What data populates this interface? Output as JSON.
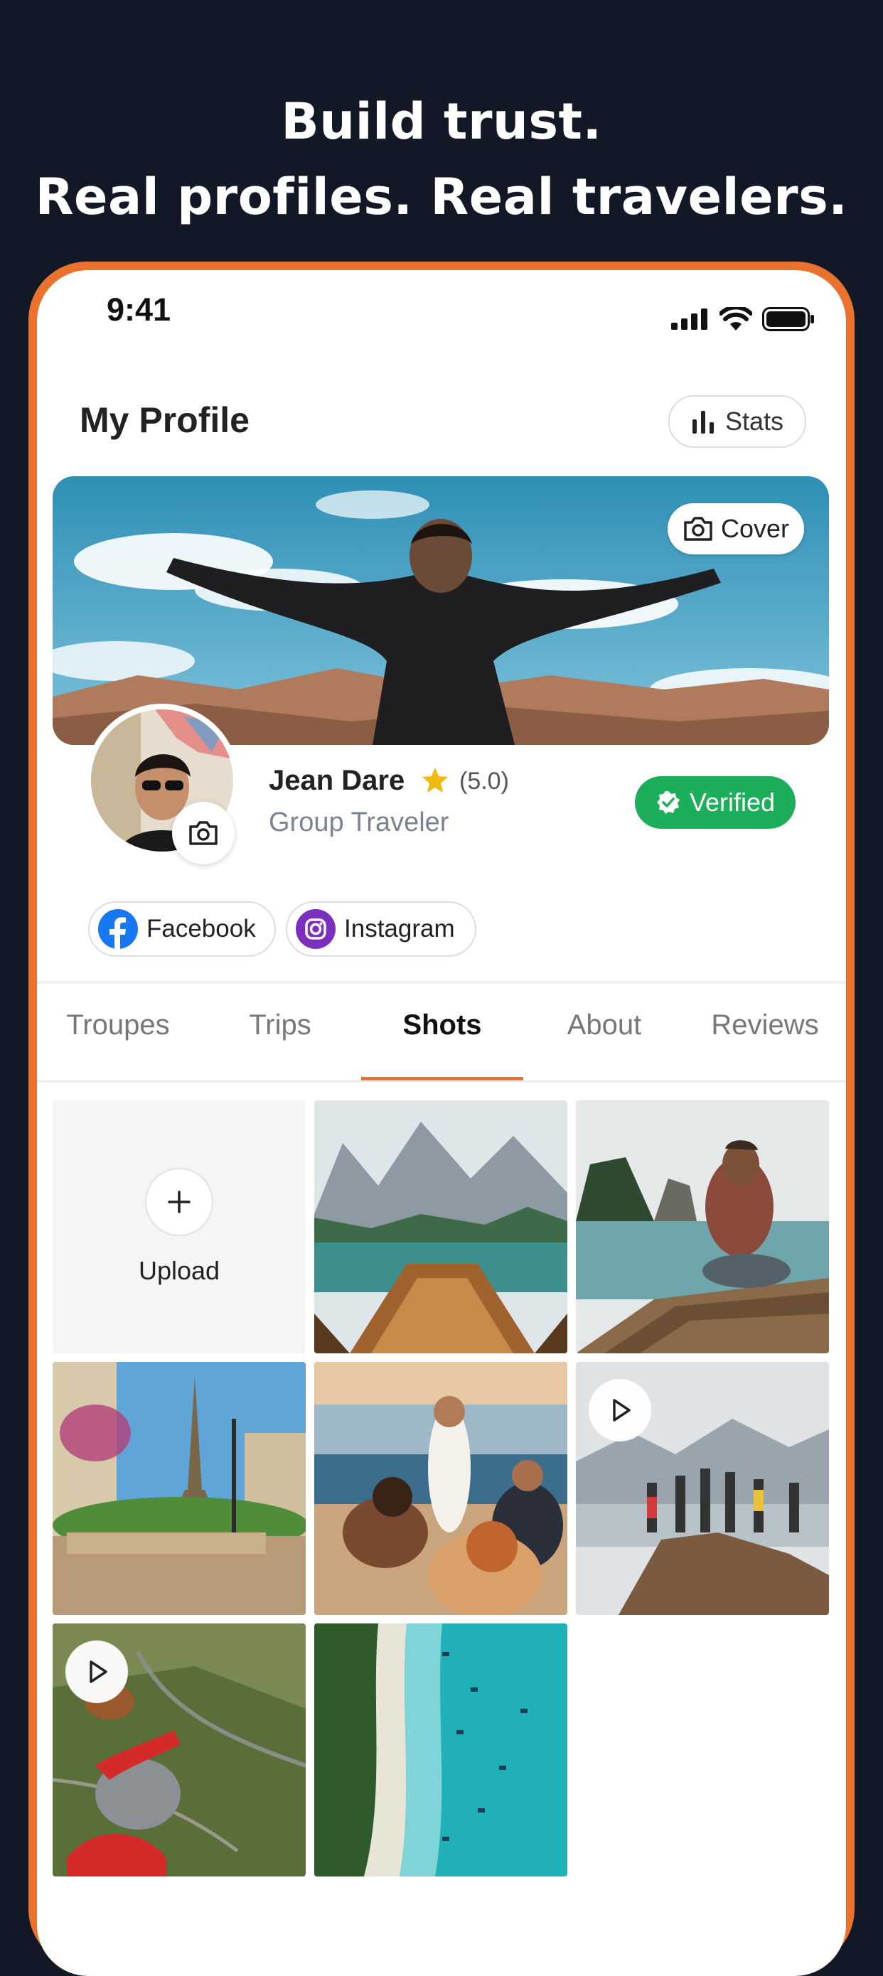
{
  "headline": {
    "line1": "Build trust.",
    "line2": "Real profiles. Real travelers."
  },
  "status_bar": {
    "time": "9:41",
    "icons": [
      "signal-icon",
      "wifi-icon",
      "battery-icon"
    ]
  },
  "header": {
    "title": "My Profile",
    "stats_label": "Stats"
  },
  "cover": {
    "button_label": "Cover"
  },
  "profile": {
    "name": "Jean Dare",
    "rating": "(5.0)",
    "role": "Group Traveler",
    "verified_label": "Verified"
  },
  "socials": [
    {
      "label": "Facebook",
      "icon": "facebook-icon",
      "color": "#1877F2"
    },
    {
      "label": "Instagram",
      "icon": "instagram-icon",
      "color": "#7B2FBE"
    }
  ],
  "tabs": [
    "Troupes",
    "Trips",
    "Shots",
    "About",
    "Reviews"
  ],
  "active_tab": "Shots",
  "grid": {
    "upload_label": "Upload",
    "tiles": [
      {
        "kind": "upload"
      },
      {
        "kind": "photo",
        "subject": "mountain lake boat"
      },
      {
        "kind": "photo",
        "subject": "man on boat bow"
      },
      {
        "kind": "photo",
        "subject": "eiffel tower"
      },
      {
        "kind": "photo",
        "subject": "friends on boat"
      },
      {
        "kind": "video",
        "subject": "hikers on summit"
      },
      {
        "kind": "video",
        "subject": "skydiver"
      },
      {
        "kind": "photo",
        "subject": "aerial beach"
      }
    ]
  },
  "colors": {
    "accent": "#E8722E",
    "verified": "#1CAE5A",
    "background": "#121826"
  }
}
